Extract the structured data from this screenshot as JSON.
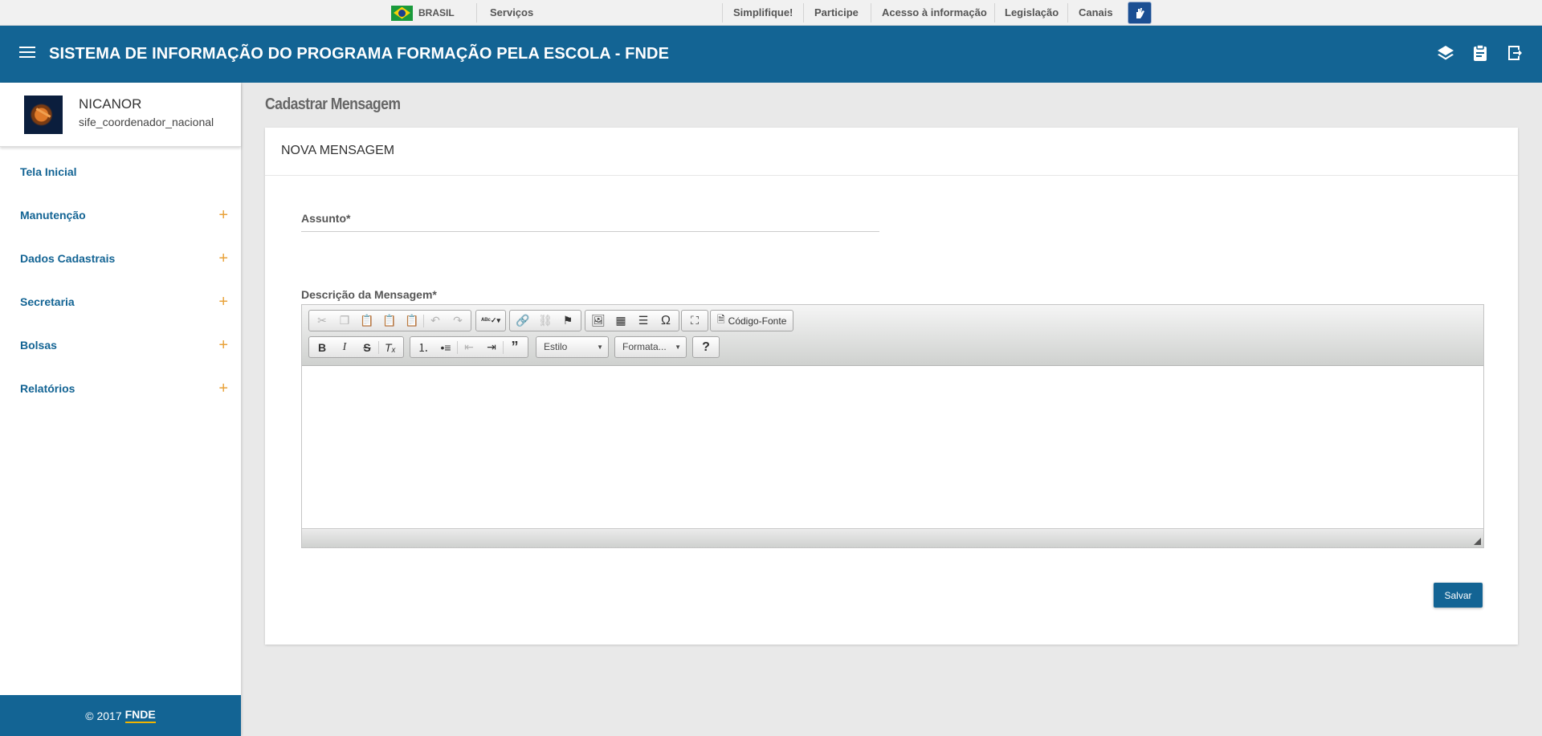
{
  "govbar": {
    "brasil": "BRASIL",
    "servicos": "Serviços",
    "links": [
      "Simplifique!",
      "Participe",
      "Acesso à informação",
      "Legislação",
      "Canais"
    ],
    "accessibility_icon": "hand-sign-icon"
  },
  "header": {
    "title": "SISTEMA DE INFORMAÇÃO DO PROGRAMA FORMAÇÃO PELA ESCOLA - FNDE",
    "icons": [
      "layers-icon",
      "clipboard-icon",
      "exit-icon"
    ],
    "color": "#136494"
  },
  "user": {
    "name": "NICANOR",
    "role": "sife_coordenador_nacional"
  },
  "sidebar": {
    "items": [
      {
        "label": "Tela Inicial",
        "expandable": false
      },
      {
        "label": "Manutenção",
        "expandable": true
      },
      {
        "label": "Dados Cadastrais",
        "expandable": true
      },
      {
        "label": "Secretaria",
        "expandable": true
      },
      {
        "label": "Bolsas",
        "expandable": true
      },
      {
        "label": "Relatórios",
        "expandable": true
      }
    ],
    "plus": "+",
    "footer": {
      "copyright": "© 2017",
      "link": "FNDE"
    }
  },
  "page": {
    "title": "Cadastrar Mensagem",
    "card_title": "NOVA MENSAGEM",
    "assunto_label": "Assunto*",
    "assunto_value": "",
    "descricao_label": "Descrição da Mensagem*",
    "editor": {
      "source_label": "Código-Fonte",
      "style_combo": "Estilo",
      "format_combo": "Formata...",
      "help": "?"
    },
    "save_label": "Salvar"
  },
  "colors": {
    "accent": "#136494",
    "plus": "#e8a23a",
    "footer_underline": "#f0b400"
  }
}
